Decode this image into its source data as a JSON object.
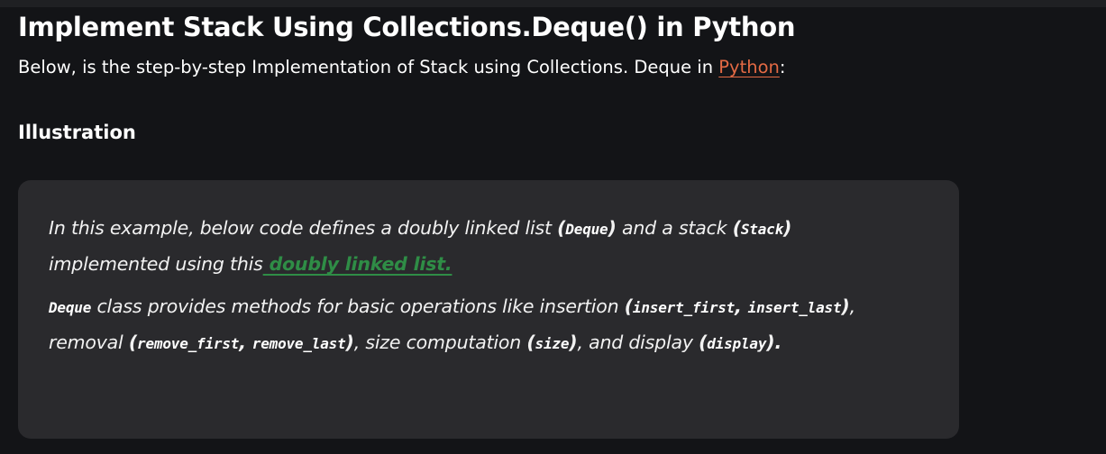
{
  "article": {
    "title": "Implement Stack Using Collections.Deque() in Python",
    "intro_text": "Below, is the step-by-step Implementation of Stack using Collections. Deque in ",
    "intro_link": "Python",
    "intro_end": ":",
    "subheading": "Illustration"
  },
  "box": {
    "p1_a": "In this example, below code defines a doubly linked list ",
    "p1_paren_open": "(",
    "p1_code_deque": "Deque",
    "p1_paren_close": ")",
    "p1_b": " and a stack ",
    "p1_paren_open2": "(",
    "p1_code_stack": "Stack",
    "p1_paren_close2": ")",
    "p1_c": " implemented using this",
    "p1_link": " doubly linked list.",
    "p2_code_deque": "Deque",
    "p2_a": " class provides methods for basic operations like insertion ",
    "p2_p1o": "(",
    "p2_code_insert_first": "insert_first",
    "p2_comma1": ", ",
    "p2_code_insert_last": "insert_last",
    "p2_p1c": ")",
    "p2_b": ", removal ",
    "p2_p2o": "(",
    "p2_code_remove_first": "remove_first",
    "p2_comma2": ", ",
    "p2_code_remove_last": "remove_last",
    "p2_p2c": ")",
    "p2_c": ", size computation ",
    "p2_p3o": "(",
    "p2_code_size": "size",
    "p2_p3c": ")",
    "p2_d": ", and display ",
    "p2_p4o": "(",
    "p2_code_display": "display",
    "p2_p4c": ")",
    "p2_e": "."
  }
}
